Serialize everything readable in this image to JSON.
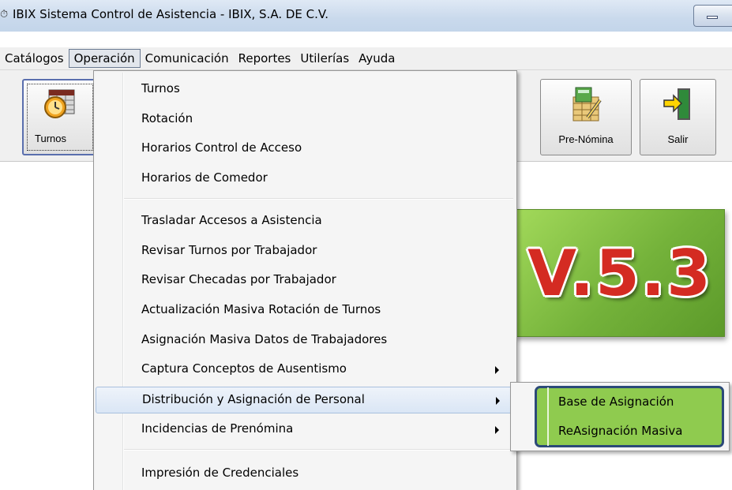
{
  "window": {
    "title": "IBIX Sistema Control de Asistencia - IBIX, S.A. DE C.V.",
    "app_icon": "clock-app-icon",
    "minimize_icon": "minimize-icon"
  },
  "menubar": {
    "items": [
      "Catálogos",
      "Operación",
      "Comunicación",
      "Reportes",
      "Utilerías",
      "Ayuda"
    ],
    "active": "Operación"
  },
  "toolbar": {
    "buttons": [
      {
        "label": "Turnos",
        "icon": "calendar-clock-icon"
      },
      {
        "label": "Pre-Nómina",
        "icon": "spreadsheet-pencil-icon"
      },
      {
        "label": "Salir",
        "icon": "exit-door-icon"
      }
    ]
  },
  "logo": {
    "text": "V.5.3"
  },
  "operacion_menu": {
    "items": [
      {
        "label": "Turnos"
      },
      {
        "label": "Rotación"
      },
      {
        "label": "Horarios Control de Acceso"
      },
      {
        "label": "Horarios de Comedor"
      },
      {
        "label": "Trasladar Accesos a Asistencia"
      },
      {
        "label": "Revisar Turnos por Trabajador"
      },
      {
        "label": "Revisar Checadas por Trabajador"
      },
      {
        "label": "Actualización Masiva Rotación de Turnos"
      },
      {
        "label": "Asignación Masiva Datos de Trabajadores"
      },
      {
        "label": "Captura Conceptos de Ausentismo",
        "submenu": true
      },
      {
        "label": "Distribución y Asignación de Personal",
        "submenu": true,
        "highlighted": true
      },
      {
        "label": "Incidencias de Prenómina",
        "submenu": true
      },
      {
        "label": "Impresión de Credenciales"
      }
    ]
  },
  "submenu": {
    "items": [
      "Base de Asignación",
      "ReAsignación Masiva"
    ],
    "highlight_color": "#8fcb4f",
    "highlight_border": "#2c4a79"
  }
}
